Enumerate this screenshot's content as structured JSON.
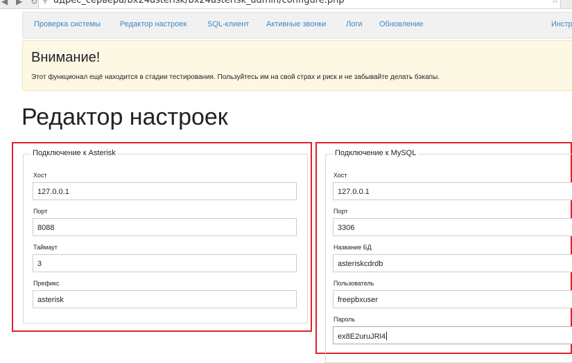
{
  "browser": {
    "url": "адрес_сервера/bx24asterisk/bx24asterisk_admin/configure.php",
    "nav_glyphs": "◀ ▶ ↻",
    "search_glyph": "⚲",
    "bookmark_glyph": "☆"
  },
  "nav": {
    "items": [
      {
        "label": "Проверка системы"
      },
      {
        "label": "Редактор настроек"
      },
      {
        "label": "SQL-клиент"
      },
      {
        "label": "Активные звонки"
      },
      {
        "label": "Логи"
      },
      {
        "label": "Обновление"
      },
      {
        "label": "Инстр"
      }
    ],
    "link_color": "#3a87c9"
  },
  "alert": {
    "title": "Внимание!",
    "text": "Этот функционал ещё находится в стадии тестирования. Пользуйтесь им на свой страх и риск и не забывайте делать бэкапы.",
    "background": "#fcf8e3"
  },
  "page": {
    "title": "Редактор настроек"
  },
  "highlight_color": "#e21f26",
  "asterisk": {
    "legend": "Подключение к Asterisk",
    "fields": [
      {
        "label": "Хост",
        "value": "127.0.0.1"
      },
      {
        "label": "Порт",
        "value": "8088"
      },
      {
        "label": "Таймаут",
        "value": "3"
      },
      {
        "label": "Префикс",
        "value": "asterisk"
      }
    ]
  },
  "mysql": {
    "legend": "Подключение к MySQL",
    "fields": [
      {
        "label": "Хост",
        "value": "127.0.0.1"
      },
      {
        "label": "Порт",
        "value": "3306"
      },
      {
        "label": "Название БД",
        "value": "asteriskcdrdb"
      },
      {
        "label": "Пользователь",
        "value": "freepbxuser"
      },
      {
        "label": "Пароль",
        "value": "ex8E2uruJRl4"
      }
    ]
  }
}
